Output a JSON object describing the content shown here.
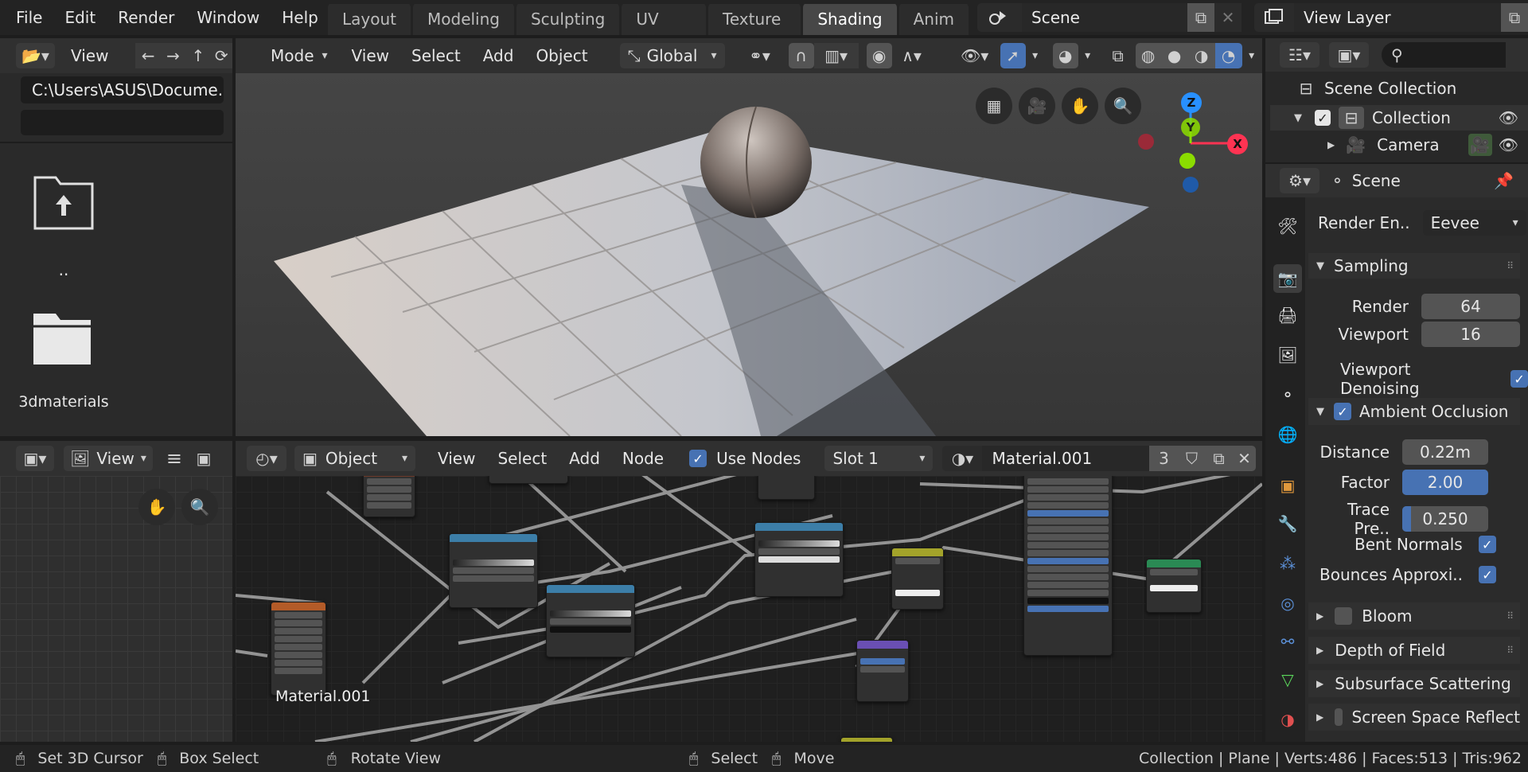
{
  "menubar": {
    "items": [
      "File",
      "Edit",
      "Render",
      "Window",
      "Help"
    ],
    "workspaces": [
      "Layout",
      "Modeling",
      "Sculpting",
      "UV Editing",
      "Texture Paint",
      "Shading",
      "Anim"
    ],
    "active_workspace": "Shading",
    "scene": "Scene",
    "view_layer": "View Layer"
  },
  "file_browser": {
    "view_label": "View",
    "path": "C:\\Users\\ASUS\\Docume..",
    "filter": "",
    "items": [
      {
        "label": "..",
        "icon": "folder-parent-icon"
      },
      {
        "label": "3dmaterials",
        "icon": "folder-icon"
      }
    ]
  },
  "viewport": {
    "mode": "Mode",
    "menus": [
      "View",
      "Select",
      "Add",
      "Object"
    ],
    "orientation": "Global"
  },
  "gizmo": {
    "x": "X",
    "y": "Y",
    "z": "Z"
  },
  "node_editor": {
    "object": "Object",
    "menus": [
      "View",
      "Select",
      "Add",
      "Node"
    ],
    "use_nodes": "Use Nodes",
    "slot": "Slot 1",
    "material": "Material.001",
    "users": "3",
    "canvas_label": "Material.001"
  },
  "image_editor": {
    "view_label": "View"
  },
  "outliner": {
    "scene_collection": "Scene Collection",
    "collection": "Collection",
    "camera": "Camera"
  },
  "properties": {
    "context": "Scene",
    "render_engine_label": "Render En..",
    "render_engine": "Eevee",
    "sampling": "Sampling",
    "render_label": "Render",
    "render_value": "64",
    "viewport_label": "Viewport",
    "viewport_value": "16",
    "viewport_denoising": "Viewport Denoising",
    "ao": "Ambient Occlusion",
    "distance_label": "Distance",
    "distance": "0.22m",
    "factor_label": "Factor",
    "factor": "2.00",
    "factor_fill": 1.0,
    "trace_label": "Trace Pre..",
    "trace": "0.250",
    "trace_fill": 0.1,
    "bent_normals": "Bent Normals",
    "bounces": "Bounces Approxi..",
    "bloom": "Bloom",
    "dof": "Depth of Field",
    "sss": "Subsurface Scattering",
    "ssr": "Screen Space Reflect"
  },
  "statusbar": {
    "set_cursor": "Set 3D Cursor",
    "box_select": "Box Select",
    "rotate": "Rotate View",
    "select": "Select",
    "move": "Move",
    "stats": "Collection | Plane | Verts:486 | Faces:513 | Tris:962"
  },
  "colors": {
    "accent": "#4772b3",
    "axis_x": "#ff3352",
    "axis_y": "#8bdc00",
    "axis_z": "#2890ff"
  }
}
